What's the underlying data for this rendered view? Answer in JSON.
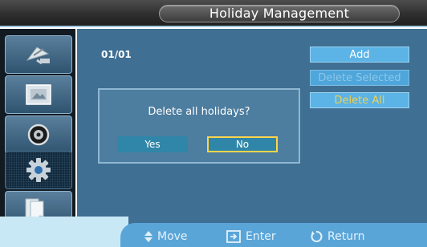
{
  "window": {
    "title": "Holiday Management"
  },
  "sidebar": {
    "items": [
      {
        "icon": "satellite-dish-icon"
      },
      {
        "icon": "picture-icon"
      },
      {
        "icon": "sound-icon"
      },
      {
        "icon": "setup-gear-icon",
        "active": true
      },
      {
        "icon": "multi-screen-icon"
      }
    ]
  },
  "main": {
    "page_indicator": "01/01",
    "buttons": {
      "add": "Add",
      "delete_selected": "Delete Selected",
      "delete_all": "Delete All"
    }
  },
  "dialog": {
    "message": "Delete all holidays?",
    "yes": "Yes",
    "no": "No",
    "focused": "No"
  },
  "help_bar": {
    "move": "Move",
    "enter": "Enter",
    "return": "Return"
  },
  "colors": {
    "title_bar": "#2f2f2f",
    "panel": "#3f6f93",
    "button": "#5bb3e6",
    "highlight_text": "#f0d050",
    "focus_border": "#ffd54a",
    "help_bar": "#5aa5d8"
  }
}
